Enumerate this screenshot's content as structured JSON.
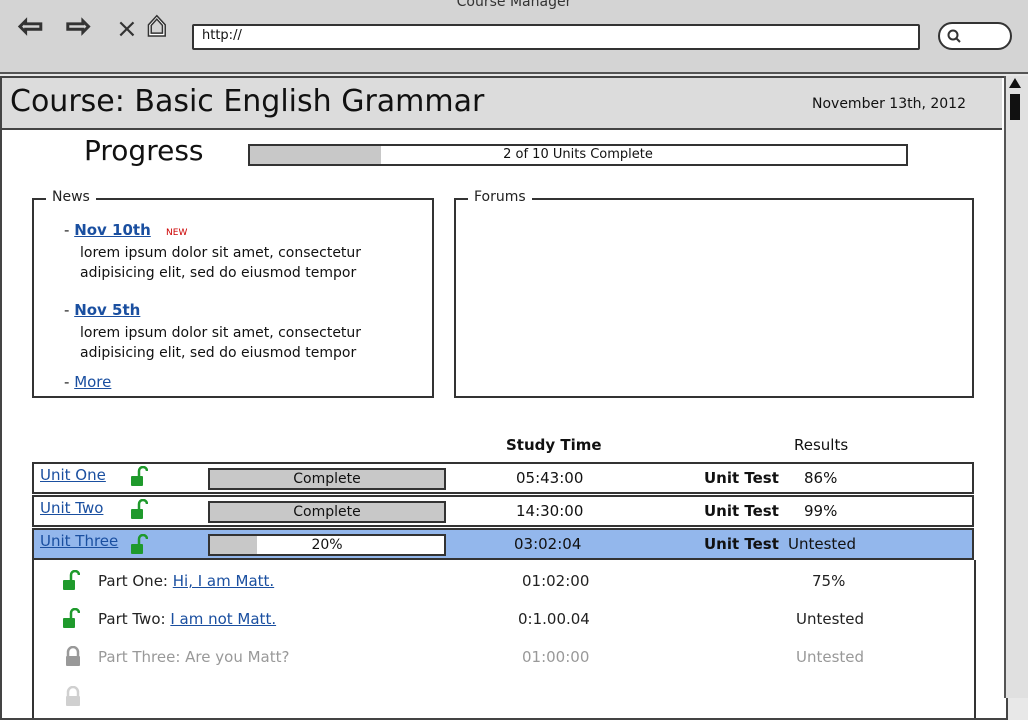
{
  "window": {
    "title": "Course Manager"
  },
  "browser": {
    "url": "http://",
    "nav_back": "⇦",
    "nav_forward": "⇨",
    "nav_stop": "×",
    "nav_home": "⌂"
  },
  "header": {
    "title": "Course: Basic English Grammar",
    "date": "November 13th, 2012"
  },
  "progress": {
    "label": "Progress",
    "text": "2 of 10 Units Complete",
    "fraction": 0.2
  },
  "news": {
    "legend": "News",
    "items": [
      {
        "date": "Nov 10th",
        "badge": "NEW",
        "body1": "lorem ipsum dolor sit amet, consectetur",
        "body2": "adipisicing elit, sed do eiusmod tempor"
      },
      {
        "date": "Nov 5th",
        "badge": "",
        "body1": "lorem ipsum dolor sit amet, consectetur",
        "body2": "adipisicing elit, sed do eiusmod tempor"
      }
    ],
    "more": "More"
  },
  "forums": {
    "legend": "Forums"
  },
  "table": {
    "study_time_header": "Study Time",
    "results_header": "Results"
  },
  "units": [
    {
      "name": "Unit One",
      "status": "Complete",
      "fraction": 1.0,
      "study_time": "05:43:00",
      "test_label": "Unit Test",
      "result": "86%"
    },
    {
      "name": "Unit Two",
      "status": "Complete",
      "fraction": 1.0,
      "study_time": "14:30:00",
      "test_label": "Unit Test",
      "result": "99%"
    },
    {
      "name": "Unit Three",
      "status": "20%",
      "fraction": 0.2,
      "study_time": "03:02:04",
      "test_label": "Unit Test",
      "result": "Untested"
    }
  ],
  "parts": [
    {
      "prefix": "Part One: ",
      "link": "Hi, I am Matt.",
      "time": "01:02:00",
      "result": "75%",
      "locked": false
    },
    {
      "prefix": "Part Two: ",
      "link": "I am not Matt.",
      "time": "0:1.00.04",
      "result": "Untested",
      "locked": false
    },
    {
      "prefix": "Part Three: Are you Matt?",
      "link": "",
      "time": "01:00:00",
      "result": "Untested",
      "locked": true
    }
  ],
  "colors": {
    "selected_row": "#93b7ec",
    "link": "#1a4fa0",
    "unlocked": "#1f9a2c",
    "locked": "#999999",
    "new_badge": "#cc0000"
  }
}
